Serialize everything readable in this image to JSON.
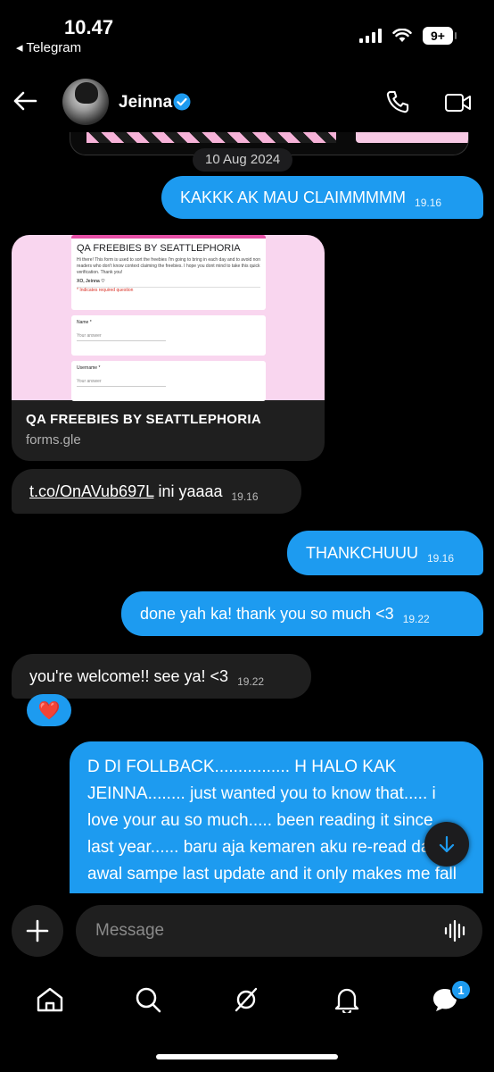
{
  "status_bar": {
    "time": "10.47",
    "back_app": "◂ Telegram",
    "battery": "9+"
  },
  "header": {
    "contact_name": "Jeinna"
  },
  "date_separator": "10 Aug 2024",
  "messages": [
    {
      "direction": "out",
      "text": "KAKKK AK MAU CLAIMMMMM",
      "time": "19.16"
    },
    {
      "direction": "in",
      "type": "link_card",
      "card_title": "QA FREEBIES BY SEATTLEPHORIA",
      "card_domain": "forms.gle"
    },
    {
      "direction": "in",
      "link": "t.co/OnAVub697L",
      "text": " ini yaaaa",
      "time": "19.16"
    },
    {
      "direction": "out",
      "text": "THANKCHUUU",
      "time": "19.16"
    },
    {
      "direction": "out",
      "text": "done yah ka! thank you so much <3",
      "time": "19.22"
    },
    {
      "direction": "in",
      "text": "you're welcome!! see ya! <3",
      "time": "19.22",
      "reaction": "❤️"
    },
    {
      "direction": "out",
      "text": "D DI FOLLBACK................ H HALO KAK JEINNA........ just wanted you to know that..... i love your au so much..... been reading it since last year...... baru aja kemaren aku re-read dari awal sampe last update and it only makes me fall even more deeper...... thank you so"
    }
  ],
  "form_preview": {
    "title": "QA FREEBIES BY SEATTLEPHORIA",
    "description": "Hi there! This form is used to sort the freebies I'm going to bring in each day and to avoid non readers who don't know context claiming the freebies. I hope you dont mind to take this quick verification. Thank you!",
    "signature": "XO, Jeinna ♡",
    "required_note": "* Indicates required question",
    "questions": [
      {
        "label": "Name *",
        "placeholder": "Your answer"
      },
      {
        "label": "Username *",
        "placeholder": "Your answer"
      }
    ]
  },
  "composer": {
    "placeholder": "Message"
  },
  "bottom_nav": {
    "messages_badge": "1"
  },
  "colors": {
    "accent": "#1d9bf0",
    "incoming_bubble": "#1f1f1f",
    "background": "#000000"
  }
}
